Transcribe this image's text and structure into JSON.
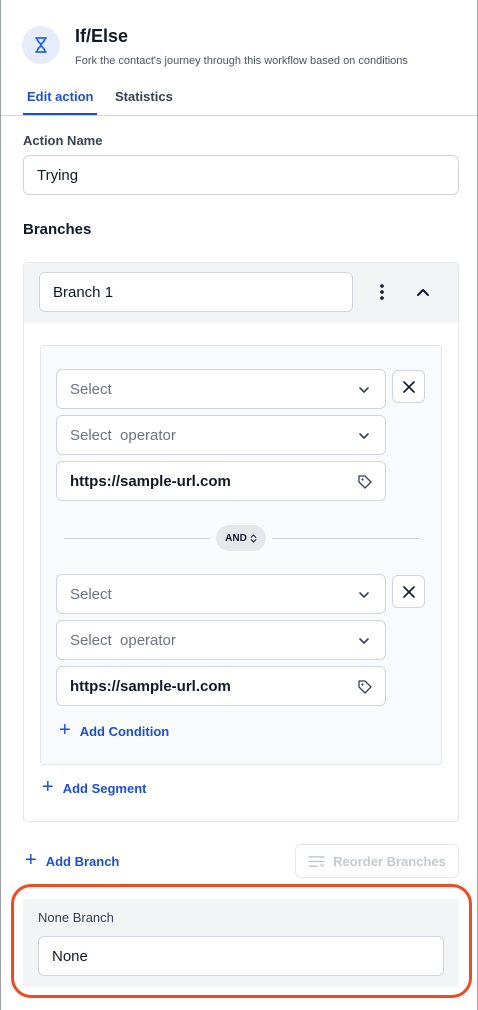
{
  "header": {
    "icon": "hourglass-icon",
    "title": "If/Else",
    "subtitle": "Fork the contact's journey through this workflow based on conditions"
  },
  "tabs": [
    {
      "label": "Edit action",
      "active": true
    },
    {
      "label": "Statistics",
      "active": false
    }
  ],
  "action_name": {
    "label": "Action Name",
    "value": "Trying"
  },
  "branches": {
    "title": "Branches",
    "items": [
      {
        "name": "Branch 1",
        "conditions": [
          {
            "field_placeholder": "Select",
            "operator_placeholder": "Select  operator",
            "value": "https://sample-url.com"
          },
          {
            "field_placeholder": "Select",
            "operator_placeholder": "Select  operator",
            "value": "https://sample-url.com"
          }
        ],
        "joiner": "AND",
        "add_condition_label": "Add Condition",
        "add_segment_label": "Add Segment"
      }
    ],
    "add_branch_label": "Add Branch",
    "reorder_label": "Reorder Branches"
  },
  "none_branch": {
    "label": "None Branch",
    "value": "None"
  },
  "colors": {
    "accent": "#1d4ed8",
    "highlight": "#f04a23"
  }
}
